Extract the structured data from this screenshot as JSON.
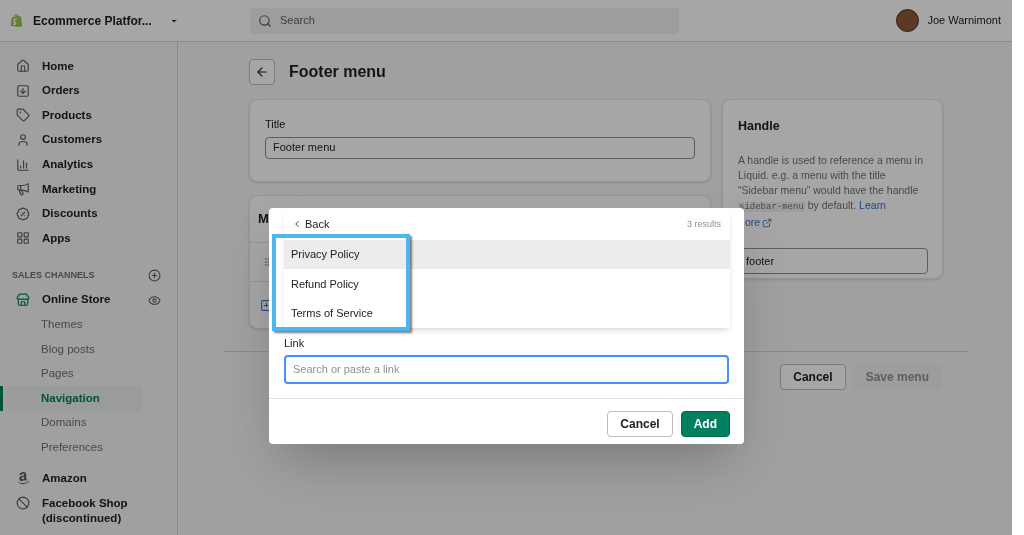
{
  "store": {
    "name": "Ecommerce Platfor..."
  },
  "search": {
    "placeholder": "Search"
  },
  "user": {
    "name": "Joe Warnimont"
  },
  "sidebar": {
    "items": [
      {
        "label": "Home"
      },
      {
        "label": "Orders"
      },
      {
        "label": "Products"
      },
      {
        "label": "Customers"
      },
      {
        "label": "Analytics"
      },
      {
        "label": "Marketing"
      },
      {
        "label": "Discounts"
      },
      {
        "label": "Apps"
      }
    ],
    "section": "SALES CHANNELS",
    "channel": {
      "label": "Online Store",
      "children": [
        {
          "label": "Themes",
          "selected": false
        },
        {
          "label": "Blog posts",
          "selected": false
        },
        {
          "label": "Pages",
          "selected": false
        },
        {
          "label": "Navigation",
          "selected": true
        },
        {
          "label": "Domains",
          "selected": false
        },
        {
          "label": "Preferences",
          "selected": false
        }
      ]
    },
    "more_channels": [
      {
        "label": "Amazon"
      },
      {
        "label": "Facebook Shop (discontinued)"
      }
    ]
  },
  "page": {
    "title": "Footer menu",
    "title_card": {
      "label": "Title",
      "value": "Footer menu"
    },
    "menu_card": {
      "title": "M"
    },
    "handle_card": {
      "title": "Handle",
      "description": "A handle is used to reference a menu in Liquid. e.g. a menu with the title “Sidebar menu” would have the handle",
      "code": "sidebar-menu",
      "after_code": "by default.",
      "link": "Learn",
      "link_rest": "ore",
      "value": "footer"
    },
    "buttons": [
      {
        "label": "Cancel",
        "kind": "secondary"
      },
      {
        "label": "Save menu",
        "kind": "disabled"
      }
    ]
  },
  "modal": {
    "popover": {
      "back": "Back",
      "count": "3 results",
      "results": [
        {
          "label": "Privacy Policy",
          "selected": true
        },
        {
          "label": "Refund Policy",
          "selected": false
        },
        {
          "label": "Terms of Service",
          "selected": false
        }
      ]
    },
    "link": {
      "label": "Link",
      "placeholder": "Search or paste a link"
    },
    "buttons": [
      {
        "label": "Cancel",
        "kind": "secondary"
      },
      {
        "label": "Add",
        "kind": "primary"
      }
    ]
  }
}
